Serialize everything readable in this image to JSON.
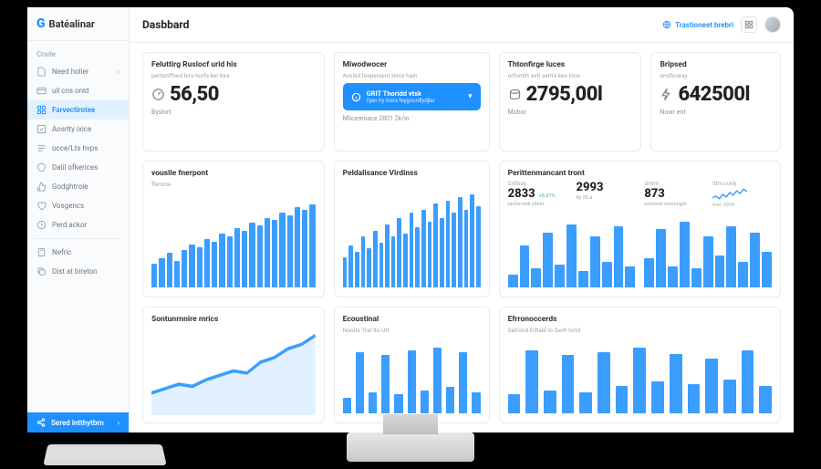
{
  "brand": "Batéalinar",
  "sidebar": {
    "head": "Crade",
    "items": [
      {
        "icon": "doc",
        "label": "Need holier",
        "chev": true
      },
      {
        "icon": "card",
        "label": "ull cns onld"
      },
      {
        "icon": "grid",
        "label": "Farvectirotee",
        "active": true
      },
      {
        "icon": "check",
        "label": "Aosrlty ixice"
      },
      {
        "icon": "lines",
        "label": "occe/Lts hvps"
      },
      {
        "icon": "shield",
        "label": "Dalil ofkerices"
      },
      {
        "icon": "thumb",
        "label": "Godghtrole"
      },
      {
        "icon": "heart",
        "label": "Vosgencs"
      },
      {
        "icon": "clock",
        "label": "Perd ackor"
      }
    ],
    "bottom": [
      {
        "icon": "calc",
        "label": "Nefric"
      },
      {
        "icon": "copy",
        "label": "Dist at bireton"
      }
    ],
    "cta": "Sered intthytbrn"
  },
  "topbar": {
    "title": "Dasbbard",
    "link": "Trastioneet brebri"
  },
  "cards": {
    "m1": {
      "title": "Feluttirg Ruslocf urid his",
      "sub": "pertonffned birs teofs ker kirs",
      "value": "56,50",
      "foot": "Byslort",
      "icon": "gauge"
    },
    "m2_head": {
      "title": "Miwodwocer",
      "sub": "Avolsd fespersent terce hain"
    },
    "m2_notice": {
      "line1": "GRIT Thoridd vtsk",
      "line2": "Gjen lry insrs feygoordlydjler"
    },
    "m2_foot": "Mlicerenace 2801 2k/in",
    "m3": {
      "title": "Thtonfirge luces",
      "sub": "orfomitt astl sem's kes lnns",
      "value": "2795,00l",
      "foot": "Mobor",
      "icon": "coin"
    },
    "m4": {
      "title": "Bripsed",
      "sub": "onoficeray",
      "value": "642500l",
      "foot": "Nowr ent",
      "icon": "bolt"
    },
    "c1": {
      "title": "vouslle fnerpont",
      "ylab": "fleronsı"
    },
    "c2": {
      "title": "Peldalisance Virdinss"
    },
    "c3": {
      "title": "Perittenmancant tront",
      "s1l": "Cntleoy",
      "s1v": "2833",
      "s1d": "+6.01%",
      "s1s": "oinfornedl sitest",
      "s2l": "",
      "s2v": "2993",
      "s2d": "",
      "s2s": "tly 20.a",
      "s3l": "Unimr",
      "s3v": "873",
      "s3s": "onmoral smunngst",
      "s4l": "Stm cunly",
      "s4s": "insc 2019"
    },
    "c4": {
      "title": "Sontunrnnire mrics"
    },
    "c5": {
      "title": "Ecoustinal",
      "sub": "Nooîte Trst lto Utl"
    },
    "c6": {
      "title": "Efrronoccerds",
      "sub": "Setrond Edtalé to Swih hctd"
    }
  },
  "chart_data": [
    {
      "type": "bar",
      "title": "vouslle fnerpont",
      "values": [
        18,
        22,
        26,
        20,
        28,
        32,
        30,
        36,
        34,
        40,
        38,
        44,
        42,
        48,
        46,
        52,
        50,
        56,
        54,
        60,
        58,
        62
      ],
      "ylim": [
        0,
        70
      ]
    },
    {
      "type": "bar",
      "title": "Peldalisance Virdinss",
      "values": [
        20,
        28,
        24,
        34,
        26,
        38,
        30,
        42,
        34,
        46,
        36,
        50,
        40,
        52,
        44,
        56,
        46,
        58,
        50,
        60,
        52,
        62,
        54
      ],
      "ylim": [
        0,
        70
      ]
    },
    {
      "type": "bar",
      "title": "Perittenmancant tront left",
      "values": [
        12,
        40,
        18,
        52,
        22,
        60,
        16,
        48,
        24,
        58,
        20
      ],
      "ylim": [
        0,
        70
      ]
    },
    {
      "type": "bar",
      "title": "Perittenmancant tront right",
      "values": [
        28,
        55,
        20,
        62,
        18,
        48,
        30,
        58,
        24,
        52,
        34
      ],
      "ylim": [
        0,
        70
      ]
    },
    {
      "type": "area",
      "title": "Sontunrnnire mrics",
      "values": [
        10,
        12,
        14,
        13,
        16,
        18,
        20,
        19,
        24,
        26,
        30,
        32,
        36
      ]
    },
    {
      "type": "bar",
      "title": "Ecoustinal",
      "values": [
        15,
        58,
        20,
        55,
        18,
        60,
        22,
        62,
        25,
        58,
        20
      ],
      "ylim": [
        0,
        70
      ]
    },
    {
      "type": "bar",
      "title": "Efrronoccerds",
      "values": [
        18,
        60,
        22,
        55,
        20,
        58,
        26,
        62,
        30,
        56,
        28,
        52,
        32,
        60,
        26
      ],
      "ylim": [
        0,
        70
      ]
    },
    {
      "type": "line",
      "title": "Stm cunly spark",
      "values": [
        8,
        10,
        7,
        12,
        9,
        14,
        11,
        16,
        13,
        18,
        15
      ]
    }
  ]
}
